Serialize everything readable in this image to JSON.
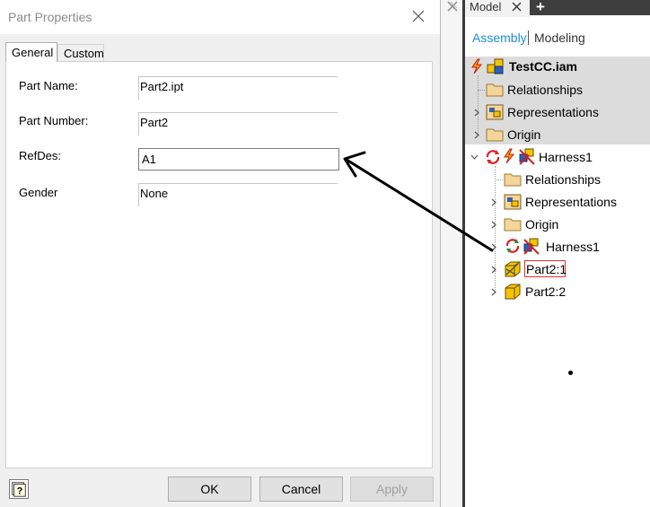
{
  "dialog": {
    "title": "Part Properties",
    "tabs": [
      {
        "label": "General",
        "active": true
      },
      {
        "label": "Custom",
        "active": false
      }
    ],
    "fields": {
      "part_name": {
        "label": "Part Name:",
        "value": "Part2.ipt"
      },
      "part_number": {
        "label": "Part Number:",
        "value": "Part2"
      },
      "refdes": {
        "label": "RefDes:",
        "value": "A1"
      },
      "gender": {
        "label": "Gender",
        "value": "None"
      }
    },
    "buttons": {
      "ok": "OK",
      "cancel": "Cancel",
      "apply": "Apply"
    },
    "help_icon": "help-question-icon"
  },
  "browser": {
    "tab_label": "Model",
    "add_tab": "+",
    "view_modes": {
      "assembly": "Assembly",
      "modeling": "Modeling"
    },
    "tree": {
      "root": "TestCC.iam",
      "root_children": [
        "Relationships",
        "Representations",
        "Origin"
      ],
      "harness": "Harness1",
      "harness_children": [
        "Relationships",
        "Representations",
        "Origin",
        "Harness1",
        "Part2:1",
        "Part2:2"
      ]
    }
  },
  "colors": {
    "accent": "#1a8fd6",
    "selection": "#dcdcdc",
    "highlight_box": "#e03030",
    "folder": "#f4d69a"
  }
}
